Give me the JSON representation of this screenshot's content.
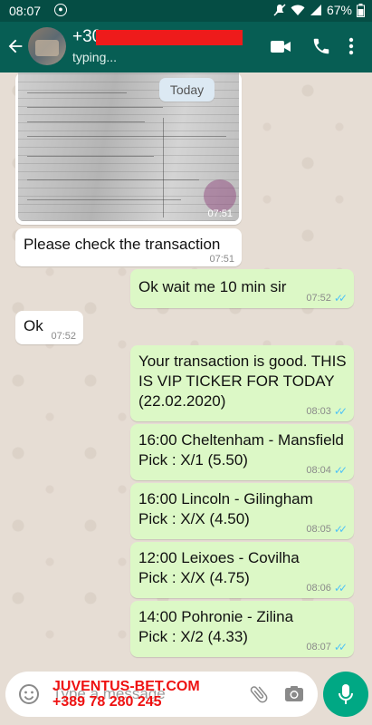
{
  "status_bar": {
    "time": "08:07",
    "battery": "67%"
  },
  "header": {
    "contact_name": "+30",
    "contact_status": "typing..."
  },
  "chat": {
    "date_label": "Today",
    "messages": [
      {
        "direction": "in",
        "type": "image",
        "time": "07:51"
      },
      {
        "direction": "in",
        "text": "Please check the transaction",
        "time": "07:51"
      },
      {
        "direction": "out",
        "text": "Ok wait me 10 min sir",
        "time": "07:52"
      },
      {
        "direction": "in",
        "text": "Ok",
        "time": "07:52"
      },
      {
        "direction": "out",
        "lines": [
          "Your transaction is good. THIS",
          "IS VIP TICKER FOR TODAY",
          "(22.02.2020)"
        ],
        "time": "08:03"
      },
      {
        "direction": "out",
        "lines": [
          "16:00 Cheltenham - Mansfield",
          "Pick : X/1 (5.50)"
        ],
        "time": "08:04"
      },
      {
        "direction": "out",
        "lines": [
          "16:00 Lincoln - Gilingham",
          "Pick : X/X (4.50)"
        ],
        "time": "08:05"
      },
      {
        "direction": "out",
        "lines": [
          "12:00 Leixoes - Covilha",
          "Pick : X/X (4.75)"
        ],
        "time": "08:06"
      },
      {
        "direction": "out",
        "lines": [
          "14:00 Pohronie - Zilina",
          "Pick : X/2 (4.33)"
        ],
        "time": "08:07"
      }
    ]
  },
  "input": {
    "placeholder": "Type a message",
    "watermark": [
      "JUVENTUS-BET.COM",
      "+389 78 280 245"
    ]
  },
  "colors": {
    "header": "#075e54",
    "outgoing": "#dcf8c6",
    "incoming": "#ffffff",
    "read_ticks": "#4fc3f7",
    "mic": "#00a884"
  }
}
